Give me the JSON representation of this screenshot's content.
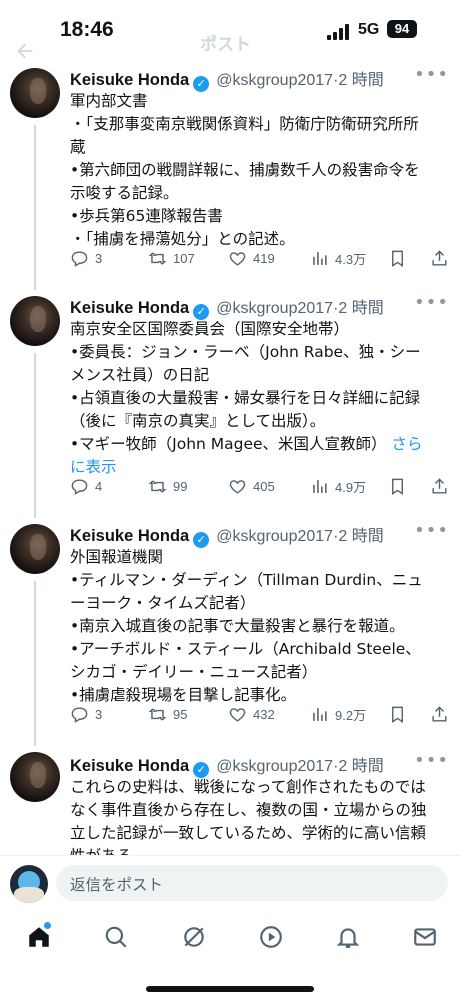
{
  "status_bar": {
    "time": "18:46",
    "network": "5G",
    "battery": "94"
  },
  "header": {
    "title": "ポスト"
  },
  "tweets": [
    {
      "name": "Keisuke Honda",
      "handle": "@kskgroup2017",
      "dot": "·",
      "age": "2 時間",
      "lines": [
        "軍内部文書",
        "・「支那事変南京戦関係資料」防衛庁防衛研究所所",
        "蔵",
        "•第六師団の戦闘詳報に、捕虜数千人の殺害命令を",
        "示唆する記録。",
        "•歩兵第65連隊報告書",
        "・「捕虜を掃蕩処分」との記述。"
      ],
      "replies": "3",
      "retweets": "107",
      "likes": "419",
      "views": "4.3万"
    },
    {
      "name": "Keisuke Honda",
      "handle": "@kskgroup2017",
      "dot": "·",
      "age": "2 時間",
      "lines": [
        "南京安全区国際委員会（国際安全地帯）",
        "•委員長：ジョン・ラーベ（John Rabe、独・シー",
        "メンス社員）の日記",
        "•占領直後の大量殺害・婦女暴行を日々詳細に記録",
        "（後に『南京の真実』として出版）。",
        "•マギー牧師（John Magee、米国人宣教師）"
      ],
      "show_more_1": "さら",
      "show_more_2": "に表示",
      "replies": "4",
      "retweets": "99",
      "likes": "405",
      "views": "4.9万"
    },
    {
      "name": "Keisuke Honda",
      "handle": "@kskgroup2017",
      "dot": "·",
      "age": "2 時間",
      "lines": [
        "外国報道機関",
        "•ティルマン・ダーディン（Tillman Durdin、ニュ",
        "ーヨーク・タイムズ記者）",
        "•南京入城直後の記事で大量殺害と暴行を報道。",
        "•アーチボルド・スティール（Archibald Steele、",
        "シカゴ・デイリー・ニュース記者）",
        "•捕虜虐殺現場を目撃し記事化。"
      ],
      "replies": "3",
      "retweets": "95",
      "likes": "432",
      "views": "9.2万"
    },
    {
      "name": "Keisuke Honda",
      "handle": "@kskgroup2017",
      "dot": "·",
      "age": "2 時間",
      "lines": [
        "これらの史料は、戦後になって創作されたものでは",
        "なく事件直後から存在し、複数の国・立場からの独",
        "立した記録が一致しているため、学術的に高い信頼",
        "性がある。"
      ]
    }
  ],
  "reply_bar": {
    "placeholder": "返信をポスト"
  },
  "tabs": [
    "home-icon",
    "search-icon",
    "grok-icon",
    "video-icon",
    "bell-icon",
    "mail-icon"
  ]
}
